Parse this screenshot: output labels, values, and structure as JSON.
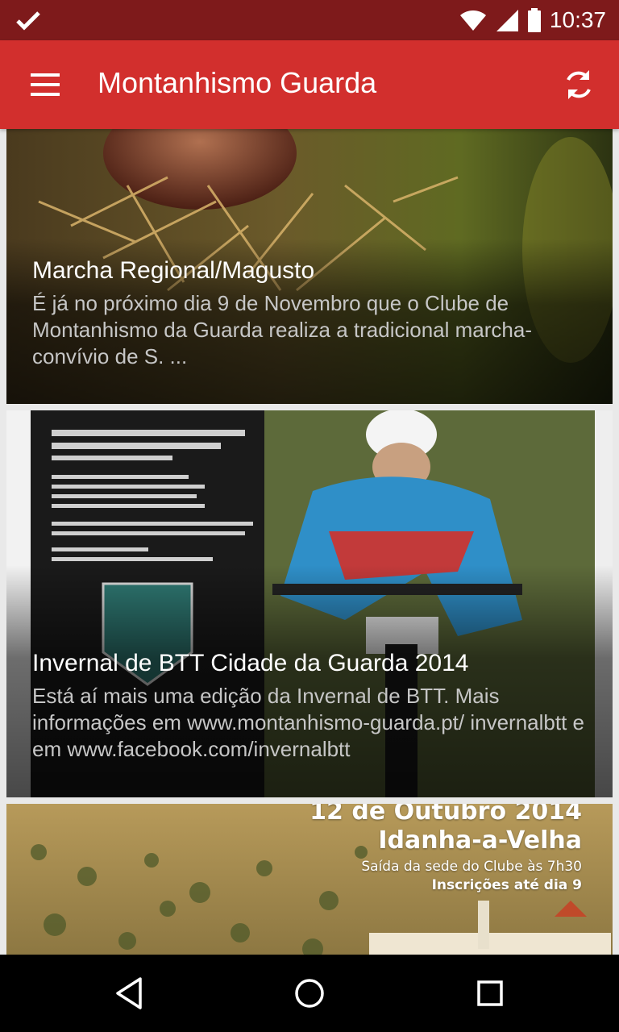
{
  "status_bar": {
    "time": "10:37"
  },
  "app_bar": {
    "title": "Montanhismo Guarda"
  },
  "feed": {
    "items": [
      {
        "title": "Marcha Regional/Magusto",
        "description": "É já no próximo dia 9 de Novembro que o Clube de Montanhismo da Guarda  realiza a tradicional marcha-convívio de S. ..."
      },
      {
        "title": "Invernal de BTT Cidade da Guarda 2014",
        "description": "Está aí mais uma edição da Invernal de BTT. Mais informações em www.montanhismo-guarda.pt/ invernalbtt e em www.facebook.com/invernalbtt"
      },
      {
        "title": "",
        "description": "",
        "poster_lines": [
          "12 de Outubro 2014",
          "Idanha-a-Velha",
          "Saída da sede do Clube às 7h30",
          "Inscrições até dia 9"
        ]
      }
    ]
  },
  "colors": {
    "status_bar": "#7e1a1b",
    "app_bar": "#d22f2d",
    "nav_bar": "#000000"
  }
}
